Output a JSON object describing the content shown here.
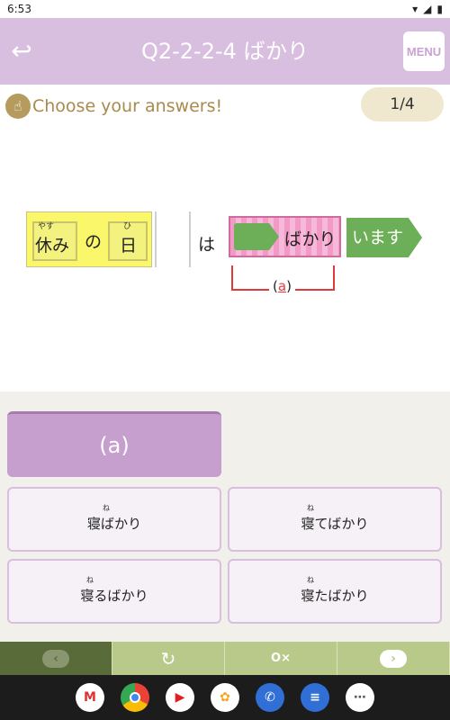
{
  "status": {
    "time": "6:53"
  },
  "header": {
    "title": "Q2-2-2-4 ばかり",
    "menu_label": "MENU"
  },
  "instruction": {
    "text": "Choose your answers!",
    "progress": "1/4"
  },
  "sentence": {
    "phrase": {
      "kanji1": "休み",
      "ruby1": "やす",
      "particle": "の",
      "kanji2": "日",
      "ruby2": "ひ"
    },
    "particle_ha": "は",
    "target_label": "ばかり",
    "verb": "います",
    "bracket_open": "(",
    "bracket_mark": "a",
    "bracket_close": ")"
  },
  "answers": {
    "slot_label": "(a)",
    "choices": [
      {
        "text": "寝ばかり",
        "ruby": "ね"
      },
      {
        "text": "寝てばかり",
        "ruby": "ね"
      },
      {
        "text": "寝るばかり",
        "ruby": "ね"
      },
      {
        "text": "寝たばかり",
        "ruby": "ね"
      }
    ]
  },
  "toolbar": {
    "prev_icon": "chevron-left-icon",
    "retry_icon": "retry-icon",
    "answer_icon": "answer-check-icon",
    "next_icon": "chevron-right-icon"
  },
  "dock": [
    "gmail-icon",
    "chrome-icon",
    "youtube-icon",
    "photos-icon",
    "phone-icon",
    "messages-icon",
    "apps-icon"
  ]
}
